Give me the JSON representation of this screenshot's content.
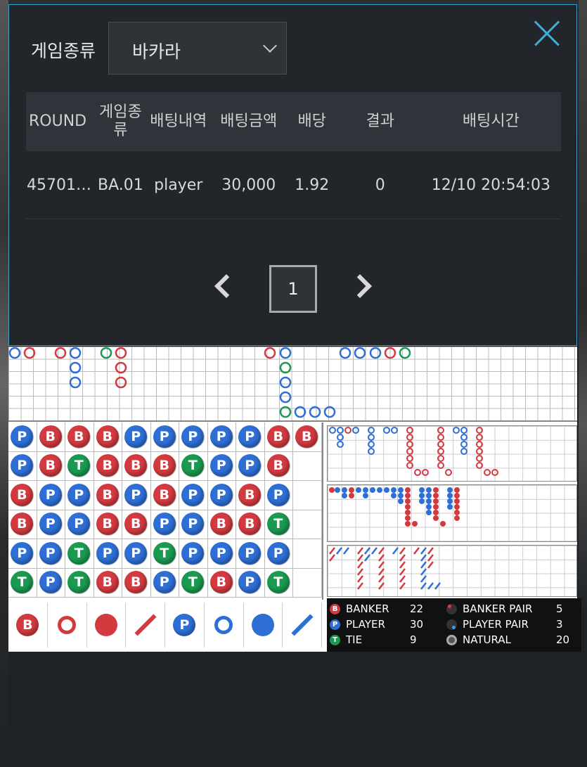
{
  "filter": {
    "label": "게임종류",
    "selected": "바카라"
  },
  "table": {
    "headers": [
      "ROUND",
      "게임종류",
      "배팅내역",
      "배팅금액",
      "배당",
      "결과",
      "배팅시간"
    ],
    "rows": [
      [
        "45701…",
        "BA.01",
        "player",
        "30,000",
        "1.92",
        "0",
        "12/10 20:54:03"
      ]
    ]
  },
  "pager": {
    "current": "1"
  },
  "bead_road": [
    [
      "P",
      "B",
      "B",
      "B",
      "P",
      "P",
      "P",
      "P",
      "P",
      "B",
      "B"
    ],
    [
      "P",
      "B",
      "T",
      "B",
      "B",
      "B",
      "T",
      "P",
      "P",
      "B",
      ""
    ],
    [
      "B",
      "P",
      "P",
      "B",
      "P",
      "B",
      "P",
      "P",
      "B",
      "P",
      ""
    ],
    [
      "B",
      "P",
      "P",
      "B",
      "B",
      "P",
      "P",
      "B",
      "B",
      "T",
      ""
    ],
    [
      "P",
      "P",
      "T",
      "P",
      "P",
      "T",
      "P",
      "P",
      "P",
      "P",
      ""
    ],
    [
      "T",
      "P",
      "T",
      "B",
      "B",
      "P",
      "T",
      "B",
      "P",
      "T",
      ""
    ]
  ],
  "legend": {
    "banker": "B",
    "player": "P"
  },
  "stats": {
    "banker": {
      "label": "BANKER",
      "value": "22"
    },
    "player": {
      "label": "PLAYER",
      "value": "30"
    },
    "tie": {
      "label": "TIE",
      "value": "9"
    },
    "banker_pair": {
      "label": "BANKER PAIR",
      "value": "5"
    },
    "player_pair": {
      "label": "PLAYER PAIR",
      "value": "3"
    },
    "natural": {
      "label": "NATURAL",
      "value": "20"
    }
  },
  "colors": {
    "banker": "#d33a40",
    "player": "#2e6fd6",
    "tie": "#1a9a50",
    "accent": "#3aa0c8"
  }
}
